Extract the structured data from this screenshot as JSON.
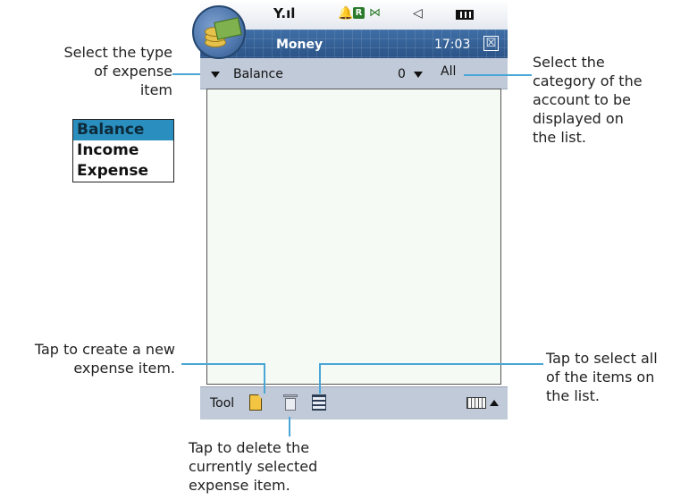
{
  "status_bar": {
    "icons": [
      "signal-icon",
      "alarm-bell-icon",
      "r-icon",
      "connection-icon",
      "speaker-icon",
      "battery-icon"
    ]
  },
  "title_bar": {
    "app_name": "Money",
    "time": "17:03",
    "close_glyph": "☒"
  },
  "filter_bar": {
    "type_value": "Balance",
    "count": "0",
    "category_value": "All"
  },
  "toolbar": {
    "tool_label": "Tool",
    "icons": [
      "new-item-icon",
      "delete-icon",
      "select-all-icon",
      "keyboard-icon"
    ]
  },
  "type_options": [
    "Balance",
    "Income",
    "Expense"
  ],
  "selected_type": "Balance",
  "callouts": {
    "type_select": [
      "Select the type",
      "of expense",
      "item"
    ],
    "category_select": [
      "Select the",
      "category of the",
      "account to be",
      "displayed on",
      "the list."
    ],
    "create_item": [
      "Tap to create a new",
      "expense item."
    ],
    "select_all": [
      "Tap to select all",
      "of the items on",
      "the list."
    ],
    "delete_item": [
      "Tap to delete the",
      "currently selected",
      "expense item."
    ]
  },
  "colors": {
    "accent": "#4aa6d6",
    "title_bar": "#2f5a90",
    "bar_gray": "#c1cad8"
  }
}
